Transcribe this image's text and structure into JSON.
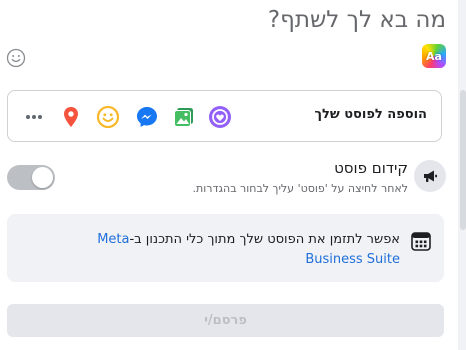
{
  "composer": {
    "placeholder": "מה בא לך לשתף?",
    "bg_picker_label": "Aa"
  },
  "add_to_post": {
    "label": "הוספה לפוסט שלך",
    "icons": [
      "avatar-sticker-icon",
      "photo-video-icon",
      "messenger-icon",
      "feeling-emoji-icon",
      "location-pin-icon",
      "more-options-icon"
    ]
  },
  "boost": {
    "title": "קידום פוסט",
    "description": "לאחר לחיצה על 'פוסט' עליך לבחור בהגדרות."
  },
  "schedule_info": {
    "text": "אפשר לתזמן את הפוסט שלך מתוך כלי התכנון ב-",
    "link": "Meta Business Suite"
  },
  "publish": {
    "label": "פרסם/י"
  },
  "colors": {
    "accent": "#1877f2",
    "link": "#216fdb",
    "muted_text": "#65676b",
    "border": "#ced0d4",
    "panel_bg": "#f0f2f5",
    "disabled_button_bg": "#e4e6eb"
  }
}
